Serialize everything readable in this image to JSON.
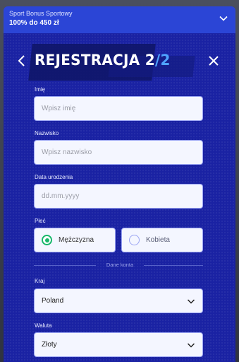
{
  "bonus": {
    "subtitle": "Sport Bonus Sportowy",
    "amount": "100% do 450 zł"
  },
  "header": {
    "title_text": "REJESTRACJA ",
    "step_current": "2",
    "step_sep": "/",
    "step_total": "2"
  },
  "form": {
    "first_name_label": "Imię",
    "first_name_placeholder": "Wpisz imię",
    "last_name_label": "Nazwisko",
    "last_name_placeholder": "Wpisz nazwisko",
    "birthdate_label": "Data urodzenia",
    "birthdate_placeholder": "dd.mm.yyyy",
    "gender_label": "Płeć",
    "gender_male": "Mężczyzna",
    "gender_female": "Kobieta",
    "gender_selected": "Mężczyzna",
    "account_section": "Dane konta",
    "country_label": "Kraj",
    "country_value": "Poland",
    "currency_label": "Waluta",
    "currency_value": "Złoty"
  },
  "icons": {
    "back": "chevron-left-icon",
    "close": "close-icon",
    "expand": "chevron-down-icon"
  },
  "colors": {
    "panel": "#1a22a3",
    "bonus_bar": "#2b45d6",
    "accent_green": "#19b86b",
    "accent_blue": "#4fa3ff"
  }
}
